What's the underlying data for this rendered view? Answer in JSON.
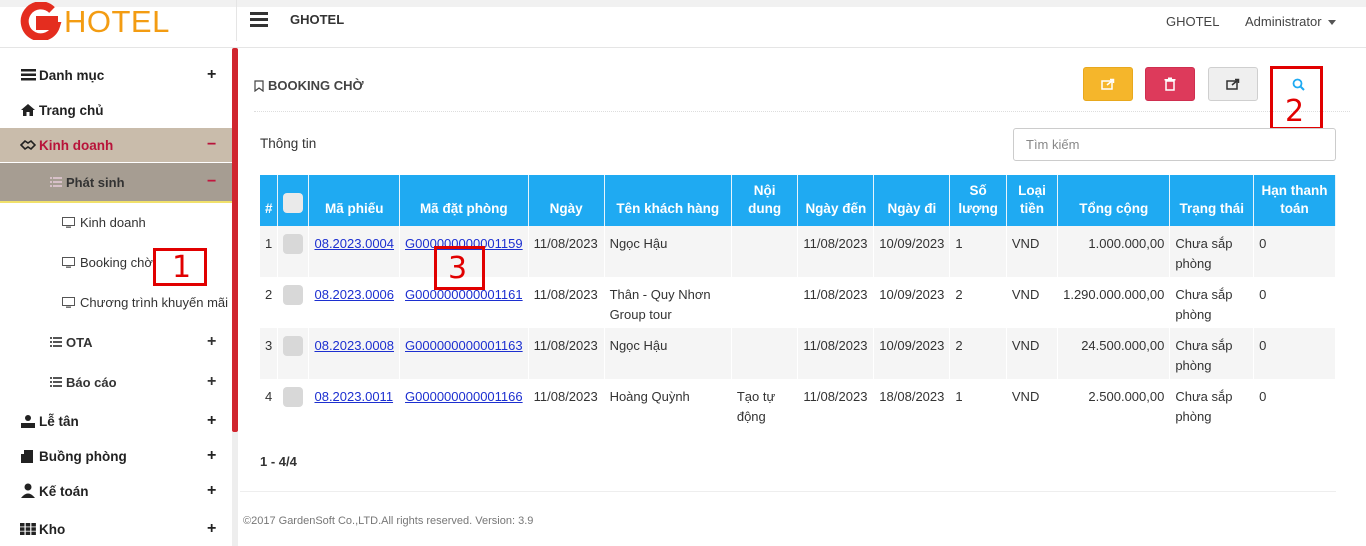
{
  "header": {
    "logo_text": "HOTEL",
    "brand": "GHOTEL",
    "company": "GHOTEL",
    "user": "Administrator"
  },
  "sidebar": {
    "items": [
      {
        "label": "Danh mục",
        "icon": "list-icon"
      },
      {
        "label": "Trang chủ",
        "icon": "home-icon"
      },
      {
        "label": "Kinh doanh",
        "icon": "handshake-icon"
      },
      {
        "label": "Phát sinh",
        "icon": "list-icon"
      },
      {
        "label": "Kinh doanh",
        "icon": "monitor-icon"
      },
      {
        "label": "Booking chờ",
        "icon": "monitor-icon"
      },
      {
        "label": "Chương trình khuyến mãi",
        "icon": "monitor-icon"
      },
      {
        "label": "OTA",
        "icon": "list-icon"
      },
      {
        "label": "Báo cáo",
        "icon": "list-icon"
      },
      {
        "label": "Lễ tân",
        "icon": "reception-icon"
      },
      {
        "label": "Buồng phòng",
        "icon": "door-icon"
      },
      {
        "label": "Kế toán",
        "icon": "accountant-icon"
      },
      {
        "label": "Kho",
        "icon": "grid-icon"
      }
    ],
    "plus": "+",
    "minus": "−"
  },
  "panel": {
    "title": "BOOKING CHỜ",
    "info_label": "Thông tin",
    "search_placeholder": "Tìm kiếm"
  },
  "annotations": [
    "1",
    "2",
    "3"
  ],
  "table": {
    "headers": [
      "#",
      "",
      "Mã phiếu",
      "Mã đặt phòng",
      "Ngày",
      "Tên khách hàng",
      "Nội dung",
      "Ngày đến",
      "Ngày đi",
      "Số lượng",
      "Loại tiền",
      "Tổng cộng",
      "Trạng thái",
      "Hạn thanh toán"
    ],
    "rows": [
      {
        "idx": "1",
        "ma_phieu": "08.2023.0004",
        "ma_dat": "G000000000001159",
        "ngay": "11/08/2023",
        "khach": "Ngọc Hậu",
        "noi_dung": "",
        "den": "11/08/2023",
        "di": "10/09/2023",
        "sl": "1",
        "tien": "VND",
        "tong": "1.000.000,00",
        "trang_thai": "Chưa sắp phòng",
        "han": "0"
      },
      {
        "idx": "2",
        "ma_phieu": "08.2023.0006",
        "ma_dat": "G000000000001161",
        "ngay": "11/08/2023",
        "khach": "Thân - Quy Nhơn Group tour",
        "noi_dung": "",
        "den": "11/08/2023",
        "di": "10/09/2023",
        "sl": "2",
        "tien": "VND",
        "tong": "1.290.000.000,00",
        "trang_thai": "Chưa sắp phòng",
        "han": "0"
      },
      {
        "idx": "3",
        "ma_phieu": "08.2023.0008",
        "ma_dat": "G000000000001163",
        "ngay": "11/08/2023",
        "khach": "Ngọc Hậu",
        "noi_dung": "",
        "den": "11/08/2023",
        "di": "10/09/2023",
        "sl": "2",
        "tien": "VND",
        "tong": "24.500.000,00",
        "trang_thai": "Chưa sắp phòng",
        "han": "0"
      },
      {
        "idx": "4",
        "ma_phieu": "08.2023.0011",
        "ma_dat": "G000000000001166",
        "ngay": "11/08/2023",
        "khach": "Hoàng Quỳnh",
        "noi_dung": "Tạo tự động",
        "den": "11/08/2023",
        "di": "18/08/2023",
        "sl": "1",
        "tien": "VND",
        "tong": "2.500.000,00",
        "trang_thai": "Chưa sắp phòng",
        "han": "0"
      }
    ]
  },
  "pager": "1 - 4/4",
  "footer": "©2017 GardenSoft Co.,LTD.All rights reserved. Version: 3.9",
  "colors": {
    "accent": "#1faaf2",
    "brand_red": "#d0262f",
    "logo_orange": "#f39c12"
  }
}
